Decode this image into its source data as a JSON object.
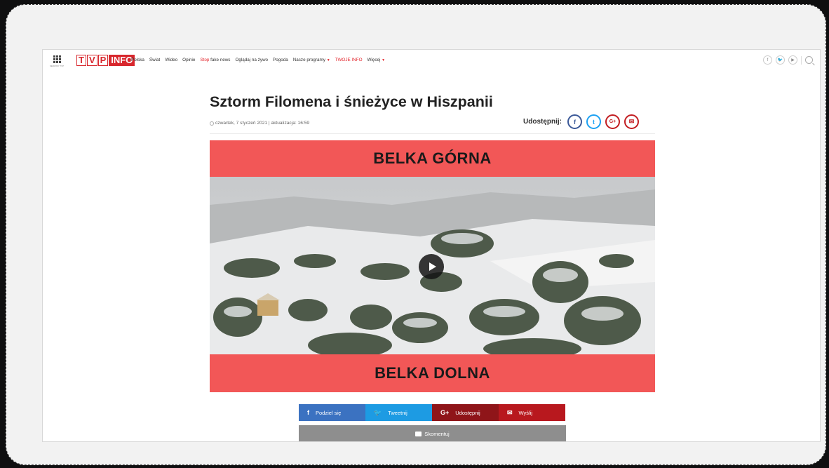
{
  "nav": {
    "apps_label": "SERWISY TVP",
    "logo_tvp": [
      "T",
      "V",
      "P"
    ],
    "logo_info": "INFO",
    "items": [
      {
        "label": "Polska"
      },
      {
        "label": "Świat"
      },
      {
        "label": "Wideo"
      },
      {
        "label": "Opinie"
      },
      {
        "label_red": "Stop",
        "label": "fake news"
      },
      {
        "label": "Oglądaj na żywo"
      },
      {
        "label": "Pogoda"
      },
      {
        "label": "Nasze programy",
        "caret": "▼"
      },
      {
        "label_red": "TWOJE INFO"
      },
      {
        "label": "Więcej",
        "caret": "▼"
      }
    ],
    "social": [
      "f",
      "🐦",
      "▶"
    ]
  },
  "article": {
    "title": "Sztorm Filomena i śnieżyce w Hiszpanii",
    "date": "czwartek, 7 styczeń 2021 | aktualizacja: 16:59",
    "share_label": "Udostępnij:",
    "share_icons": [
      "f",
      "t",
      "G+",
      "✉"
    ]
  },
  "video": {
    "top_bar": "BELKA GÓRNA",
    "bottom_bar": "BELKA DOLNA"
  },
  "share_buttons": [
    {
      "icon": "f",
      "label": "Podziel się"
    },
    {
      "icon": "🐦",
      "label": "Tweetnij"
    },
    {
      "icon": "G+",
      "label": "Udostępnij"
    },
    {
      "icon": "✉",
      "label": "Wyślij"
    }
  ],
  "comment_label": "Skomentuj",
  "colors": {
    "brand_red": "#d8272d",
    "bar_red": "#f25757",
    "facebook": "#3b72c1",
    "twitter": "#1d9be3",
    "gplus": "#8f1519",
    "mail": "#b8181e"
  }
}
